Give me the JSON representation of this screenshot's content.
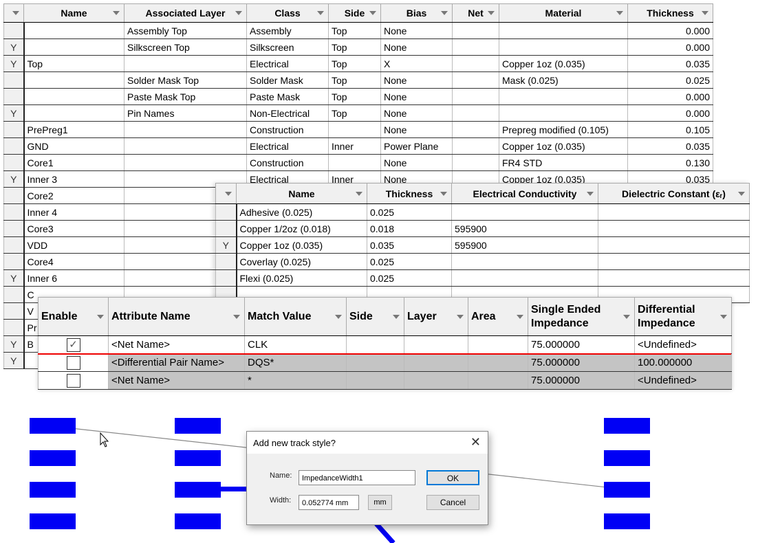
{
  "layer_table": {
    "columns": [
      "Name",
      "Associated Layer",
      "Class",
      "Side",
      "Bias",
      "Net",
      "Material",
      "Thickness"
    ],
    "rows": [
      {
        "sel": "",
        "name": "",
        "assoc": "Assembly Top",
        "class": "Assembly",
        "side": "Top",
        "bias": "None",
        "net": "",
        "material": "",
        "thickness": "0.000"
      },
      {
        "sel": "Y",
        "name": "",
        "assoc": "Silkscreen Top",
        "class": "Silkscreen",
        "side": "Top",
        "bias": "None",
        "net": "",
        "material": "",
        "thickness": "0.000"
      },
      {
        "sel": "Y",
        "name": "Top",
        "assoc": "",
        "class": "Electrical",
        "side": "Top",
        "bias": "X",
        "net": "",
        "material": "Copper 1oz (0.035)",
        "thickness": "0.035"
      },
      {
        "sel": "",
        "name": "",
        "assoc": "Solder Mask Top",
        "class": "Solder Mask",
        "side": "Top",
        "bias": "None",
        "net": "",
        "material": "Mask (0.025)",
        "thickness": "0.025"
      },
      {
        "sel": "",
        "name": "",
        "assoc": "Paste Mask Top",
        "class": "Paste Mask",
        "side": "Top",
        "bias": "None",
        "net": "",
        "material": "",
        "thickness": "0.000"
      },
      {
        "sel": "Y",
        "name": "",
        "assoc": "Pin Names",
        "class": "Non-Electrical",
        "side": "Top",
        "bias": "None",
        "net": "",
        "material": "",
        "thickness": "0.000"
      },
      {
        "sel": "",
        "name": "PrePreg1",
        "assoc": "",
        "class": "Construction",
        "side": "",
        "bias": "None",
        "net": "",
        "material": "Prepreg modified (0.105)",
        "thickness": "0.105"
      },
      {
        "sel": "",
        "name": "GND",
        "assoc": "",
        "class": "Electrical",
        "side": "Inner",
        "bias": "Power Plane",
        "net": "",
        "material": "Copper 1oz (0.035)",
        "thickness": "0.035"
      },
      {
        "sel": "",
        "name": "Core1",
        "assoc": "",
        "class": "Construction",
        "side": "",
        "bias": "None",
        "net": "",
        "material": "FR4 STD",
        "thickness": "0.130"
      },
      {
        "sel": "Y",
        "name": "Inner 3",
        "assoc": "",
        "class": "Electrical",
        "side": "Inner",
        "bias": "None",
        "net": "",
        "material": "Copper 1oz (0.035)",
        "thickness": "0.035"
      },
      {
        "sel": "",
        "name": "Core2"
      },
      {
        "sel": "",
        "name": "Inner 4"
      },
      {
        "sel": "",
        "name": "Core3"
      },
      {
        "sel": "",
        "name": "VDD"
      },
      {
        "sel": "",
        "name": "Core4"
      },
      {
        "sel": "Y",
        "name": "Inner 6"
      },
      {
        "sel": "",
        "name": "C"
      },
      {
        "sel": "",
        "name": "V"
      },
      {
        "sel": "",
        "name": "Pr"
      },
      {
        "sel": "Y",
        "name": "B"
      },
      {
        "sel": "Y",
        "name": ""
      }
    ]
  },
  "material_table": {
    "columns": [
      "Name",
      "Thickness",
      "Electrical Conductivity",
      "Dielectric Constant (εᵣ)"
    ],
    "rows": [
      {
        "sel": "",
        "name": "Adhesive (0.025)",
        "thickness": "0.025",
        "ec": ""
      },
      {
        "sel": "",
        "name": "Copper 1/2oz (0.018)",
        "thickness": "0.018",
        "ec": "595900"
      },
      {
        "sel": "Y",
        "name": "Copper 1oz (0.035)",
        "thickness": "0.035",
        "ec": "595900"
      },
      {
        "sel": "",
        "name": "Coverlay (0.025)",
        "thickness": "0.025",
        "ec": ""
      },
      {
        "sel": "",
        "name": "Flexi (0.025)",
        "thickness": "0.025",
        "ec": ""
      }
    ]
  },
  "rules_table": {
    "columns": [
      "Enable",
      "Attribute Name",
      "Match Value",
      "Side",
      "Layer",
      "Area",
      "Single Ended Impedance",
      "Differential Impedance"
    ],
    "rows": [
      {
        "enabled": true,
        "check": "✓",
        "attr": "<Net Name>",
        "match": "CLK",
        "se": "75.000000",
        "diff": "<Undefined>"
      },
      {
        "enabled": false,
        "check": "",
        "attr": "<Differential Pair Name>",
        "match": "DQS*",
        "se": "75.000000",
        "diff": "100.000000"
      },
      {
        "enabled": false,
        "check": "",
        "attr": "<Net Name>",
        "match": "*",
        "se": "75.000000",
        "diff": "<Undefined>"
      }
    ]
  },
  "dialog": {
    "title": "Add new track style?",
    "close": "✕",
    "name_label": "Name:",
    "name_value": "ImpedanceWidth1",
    "width_label": "Width:",
    "width_value": "0.052774 mm",
    "units": "mm",
    "ok": "OK",
    "cancel": "Cancel"
  },
  "colors": {
    "pad": "#0000f5",
    "highlight": "#e00000"
  }
}
